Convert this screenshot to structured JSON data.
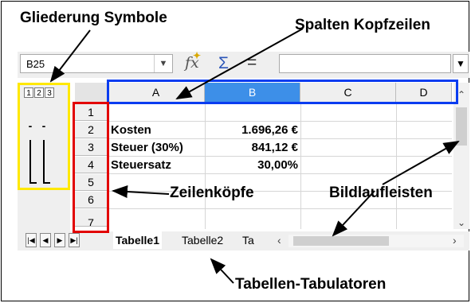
{
  "callouts": {
    "outline_symbols": "Gliederung Symbole",
    "column_headers": "Spalten Kopfzeilen",
    "row_headers": "Zeilenköpfe",
    "scrollbars": "Bildlaufleisten",
    "sheet_tabs": "Tabellen-Tabulatoren"
  },
  "formula_bar": {
    "name_box": "B25",
    "functions_icon": "fx-icon",
    "sum_icon": "sigma-icon",
    "equals": "="
  },
  "outline": {
    "levels": [
      "1",
      "2",
      "3"
    ],
    "minus": "-"
  },
  "columns": [
    "A",
    "B",
    "C",
    "D"
  ],
  "rows": [
    "1",
    "2",
    "3",
    "4",
    "5",
    "6",
    "7"
  ],
  "cells": {
    "a2": "Kosten",
    "b2": "1.696,26 €",
    "a3": "Steuer (30%)",
    "b3": "841,12 €",
    "a4": "Steuersatz",
    "b4": "30,00%"
  },
  "sheet_tabs": [
    "Tabelle1",
    "Tabelle2",
    "Ta"
  ],
  "colors": {
    "yellow": "#ffe800",
    "blue": "#0a3cf0",
    "red": "#e20000",
    "selected_column": "#3d8fe8"
  }
}
